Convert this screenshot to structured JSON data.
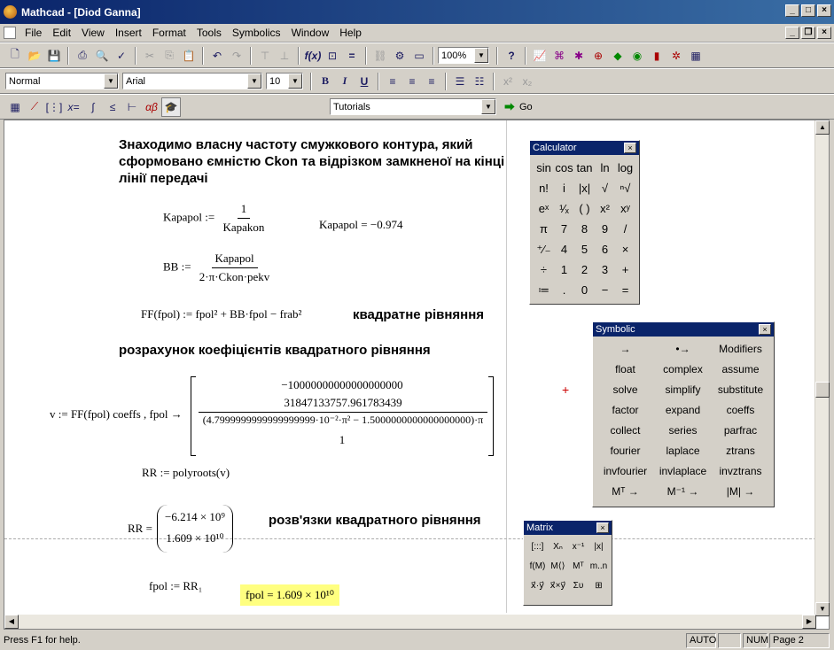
{
  "window": {
    "title": "Mathcad - [Diod Ganna]"
  },
  "menu": [
    "File",
    "Edit",
    "View",
    "Insert",
    "Format",
    "Tools",
    "Symbolics",
    "Window",
    "Help"
  ],
  "toolbar": {
    "zoom": "100%",
    "style": "Normal",
    "font": "Arial",
    "size": "10",
    "tutorials": "Tutorials",
    "go_label": "Go"
  },
  "doc": {
    "heading1": "Знаходимо власну частоту смужкового контура, який сформовано ємністю Ckon та відрізком замкненої на кінці лінії передачі",
    "eq1_lhs": "Kapapol :=",
    "eq1_num": "1",
    "eq1_den": "Kapakon",
    "eq1_result": "Kapapol = −0.974",
    "eq2_lhs": "BB :=",
    "eq2_num": "Kapapol",
    "eq2_den": "2·π·Ckon·pekv",
    "eq3": "FF(fpol) := fpol² + BB·fpol − frab²",
    "label_quad": "квадратне рівняння",
    "heading2": "розрахунок коефіцієнтів квадратного рівняння",
    "eq4_lhs": "v := FF(fpol)  coeffs , fpol  →",
    "vec_row1": "−10000000000000000000",
    "vec_row2_num": "31847133757.961783439",
    "vec_row2_den": "(4.7999999999999999999·10⁻²·π² − 1.5000000000000000000)·π",
    "vec_row3": "1",
    "eq5": "RR := polyroots(v)",
    "eq6_lhs": "RR =",
    "root1": "−6.214 × 10⁹",
    "root2": "1.609 × 10¹⁰",
    "label_roots": "розв'язки квадратного рівняння",
    "eq7": "fpol := RR₁",
    "eq8": "fpol = 1.609 × 10¹⁰"
  },
  "calculator": {
    "title": "Calculator",
    "keys": [
      "sin",
      "cos",
      "tan",
      "ln",
      "log",
      "n!",
      "i",
      "|x|",
      "√",
      "ⁿ√",
      "eˣ",
      "¹⁄ₓ",
      "( )",
      "x²",
      "xʸ",
      "π",
      "7",
      "8",
      "9",
      "/",
      "⁺⁄₋",
      "4",
      "5",
      "6",
      "×",
      "÷",
      "1",
      "2",
      "3",
      "+",
      "≔",
      ".",
      "0",
      "−",
      "="
    ]
  },
  "symbolic": {
    "title": "Symbolic",
    "items": [
      "→",
      "•→",
      "Modifiers",
      "float",
      "complex",
      "assume",
      "solve",
      "simplify",
      "substitute",
      "factor",
      "expand",
      "coeffs",
      "collect",
      "series",
      "parfrac",
      "fourier",
      "laplace",
      "ztrans",
      "invfourier",
      "invlaplace",
      "invztrans",
      "Mᵀ →",
      "M⁻¹ →",
      "|M| →"
    ]
  },
  "matrix": {
    "title": "Matrix",
    "items": [
      "[:::]",
      "Xₙ",
      "x⁻¹",
      "|x|",
      "f(M)",
      "M⟨⟩",
      "Mᵀ",
      "m..n",
      "x⃗·y⃗",
      "x⃗×y⃗",
      "Συ",
      "⊞"
    ]
  },
  "status": {
    "help": "Press F1 for help.",
    "auto": "AUTO",
    "num": "NUM",
    "page": "Page 2"
  }
}
